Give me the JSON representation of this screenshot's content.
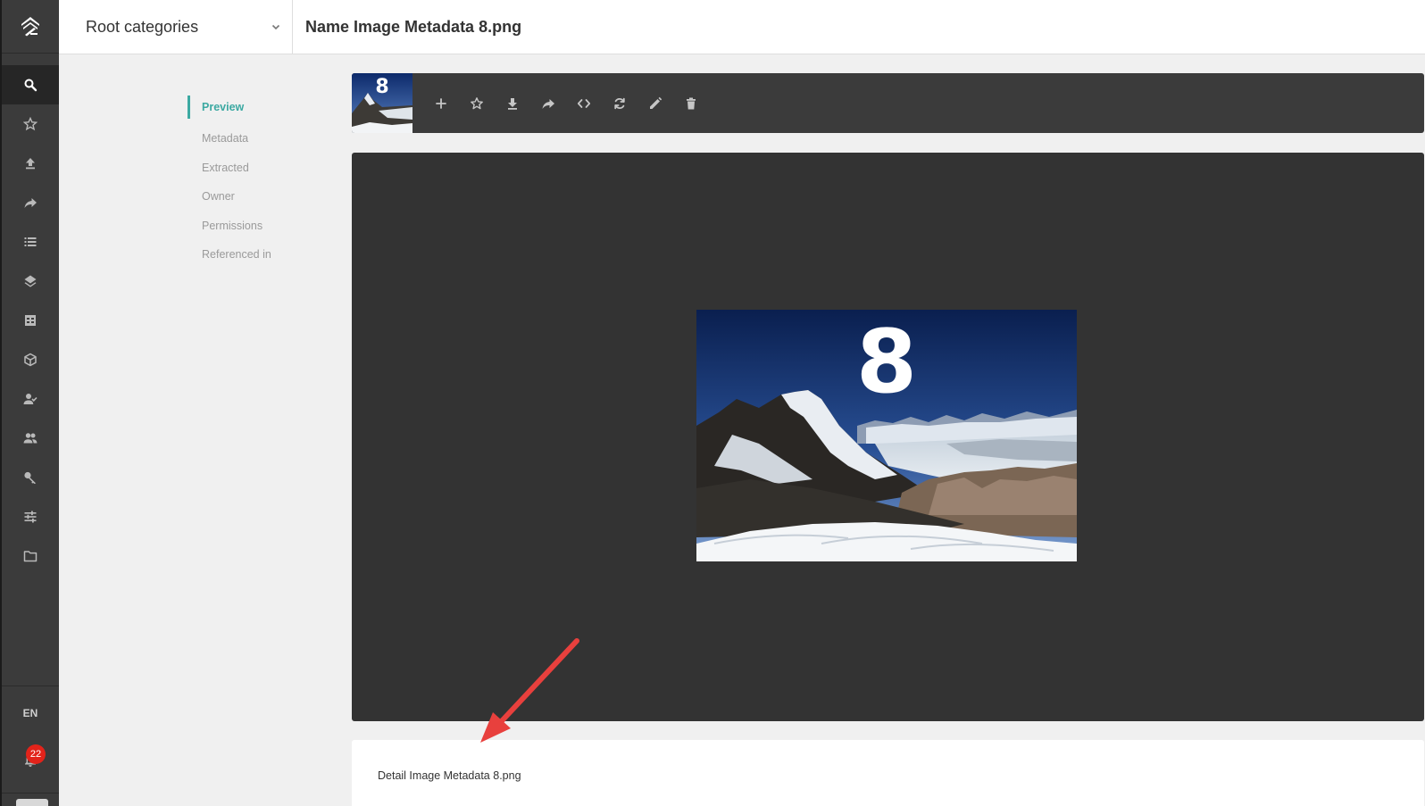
{
  "rail": {
    "nav_icons": [
      "search-icon",
      "star-icon",
      "upload-icon",
      "share-icon",
      "list-icon",
      "layers-icon",
      "table-icon",
      "cube-icon",
      "user-check-icon",
      "users-icon",
      "key-icon",
      "sliders-icon",
      "folder-icon"
    ],
    "active": "search-icon",
    "language": "EN",
    "notifications_count": "22"
  },
  "header": {
    "category_select": "Root categories",
    "title": "Name Image Metadata 8.png"
  },
  "side_menu": {
    "items": [
      "Preview",
      "Metadata",
      "Extracted",
      "Owner",
      "Permissions",
      "Referenced in"
    ],
    "active_index": 0
  },
  "toolbar": {
    "thumbnail_label": "8",
    "tools": [
      "add-icon",
      "star-icon",
      "download-icon",
      "share-icon",
      "code-icon",
      "refresh-icon",
      "edit-icon",
      "delete-icon"
    ]
  },
  "preview": {
    "image_label": "8"
  },
  "detail": {
    "text": "Detail Image Metadata 8.png"
  },
  "colors": {
    "accent": "#3ca9a2",
    "rail_bg": "#3b3b3b",
    "preview_bg": "#333333",
    "badge": "#e2231a",
    "annotation_arrow": "#e8403d"
  }
}
